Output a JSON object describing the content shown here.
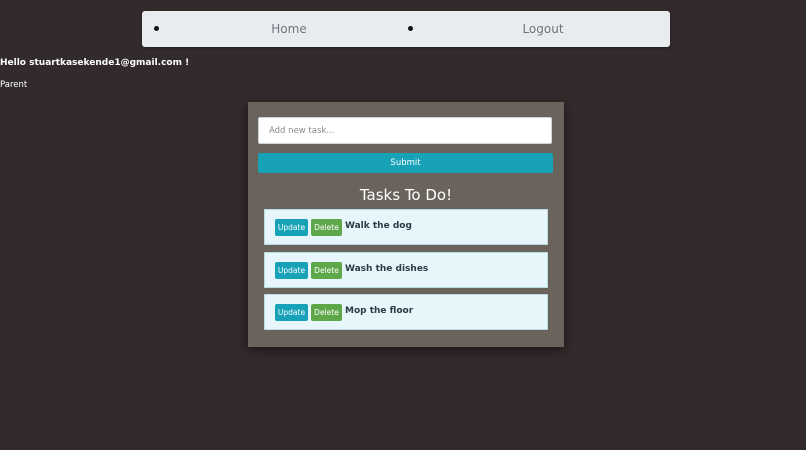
{
  "nav": {
    "items": [
      {
        "label": "Home"
      },
      {
        "label": "Logout"
      }
    ]
  },
  "user": {
    "greeting": "Hello stuartkasekende1@gmail.com !",
    "role": "Parent"
  },
  "form": {
    "placeholder": "Add new task...",
    "submit_label": "Submit"
  },
  "tasks": {
    "title": "Tasks To Do!",
    "update_label": "Update",
    "delete_label": "Delete",
    "items": [
      {
        "text": "Walk the dog"
      },
      {
        "text": "Wash the dishes"
      },
      {
        "text": "Mop the floor"
      }
    ]
  },
  "colors": {
    "background": "#332b2b",
    "navbar": "#e9ecef",
    "panel": "#6a635c",
    "primary": "#17a2b8",
    "success": "#5fa84a",
    "task_card": "#e7f6fb"
  }
}
